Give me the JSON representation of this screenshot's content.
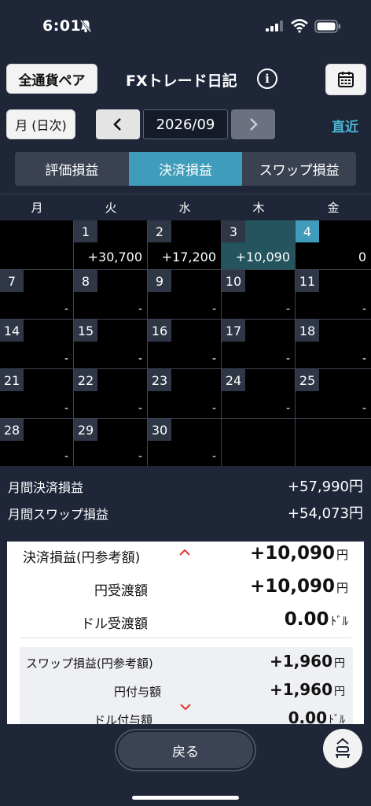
{
  "status": {
    "time": "6:01"
  },
  "header": {
    "all_pairs": "全通貨ペア",
    "title": "FXトレード日記",
    "info": "i"
  },
  "nav": {
    "mode": "月 (日次)",
    "month": "2026/09",
    "recent": "直近"
  },
  "tabs": [
    {
      "label": "評価損益",
      "active": false
    },
    {
      "label": "決済損益",
      "active": true
    },
    {
      "label": "スワップ損益",
      "active": false
    }
  ],
  "weekdays": [
    "月",
    "火",
    "水",
    "木",
    "金"
  ],
  "days": [
    {
      "day": "",
      "amount": ""
    },
    {
      "day": "1",
      "amount": "+30,700"
    },
    {
      "day": "2",
      "amount": "+17,200"
    },
    {
      "day": "3",
      "amount": "+10,090",
      "selected": true
    },
    {
      "day": "4",
      "amount": "0",
      "today": true
    },
    {
      "day": "7",
      "amount": "-"
    },
    {
      "day": "8",
      "amount": "-"
    },
    {
      "day": "9",
      "amount": "-"
    },
    {
      "day": "10",
      "amount": "-"
    },
    {
      "day": "11",
      "amount": "-"
    },
    {
      "day": "14",
      "amount": "-"
    },
    {
      "day": "15",
      "amount": "-"
    },
    {
      "day": "16",
      "amount": "-"
    },
    {
      "day": "17",
      "amount": "-"
    },
    {
      "day": "18",
      "amount": "-"
    },
    {
      "day": "21",
      "amount": "-"
    },
    {
      "day": "22",
      "amount": "-"
    },
    {
      "day": "23",
      "amount": "-"
    },
    {
      "day": "24",
      "amount": "-"
    },
    {
      "day": "25",
      "amount": "-"
    },
    {
      "day": "28",
      "amount": "-"
    },
    {
      "day": "29",
      "amount": "-"
    },
    {
      "day": "30",
      "amount": "-"
    },
    {
      "day": "",
      "amount": ""
    },
    {
      "day": "",
      "amount": ""
    }
  ],
  "summary": {
    "monthly_settled_label": "月間決済損益",
    "monthly_settled_value": "+57,990円",
    "monthly_swap_label": "月間スワップ損益",
    "monthly_swap_value": "+54,073円"
  },
  "detail": {
    "settled_label": "決済損益(円参考額)",
    "settled_value": "+10,090",
    "settled_unit": "円",
    "yen_label": "円受渡額",
    "yen_value": "+10,090",
    "yen_unit": "円",
    "usd_label": "ドル受渡額",
    "usd_value": "0.00",
    "usd_unit": "ﾄﾞﾙ",
    "swap_label": "スワップ損益(円参考額)",
    "swap_value": "+1,960",
    "swap_unit": "円",
    "yen_grant_label": "円付与額",
    "yen_grant_value": "+1,960",
    "yen_grant_unit": "円",
    "usd_grant_label": "ドル付与額",
    "usd_grant_value": "0.00",
    "usd_grant_unit": "ﾄﾞﾙ"
  },
  "footer": {
    "back": "戻る"
  },
  "icons": [
    "bell-slash-icon",
    "signal-icon",
    "wifi-icon",
    "battery-icon",
    "calendar-icon",
    "chevron-left-icon",
    "chevron-right-icon",
    "chevron-up-icon",
    "chevron-down-icon",
    "scroll-top-icon"
  ]
}
